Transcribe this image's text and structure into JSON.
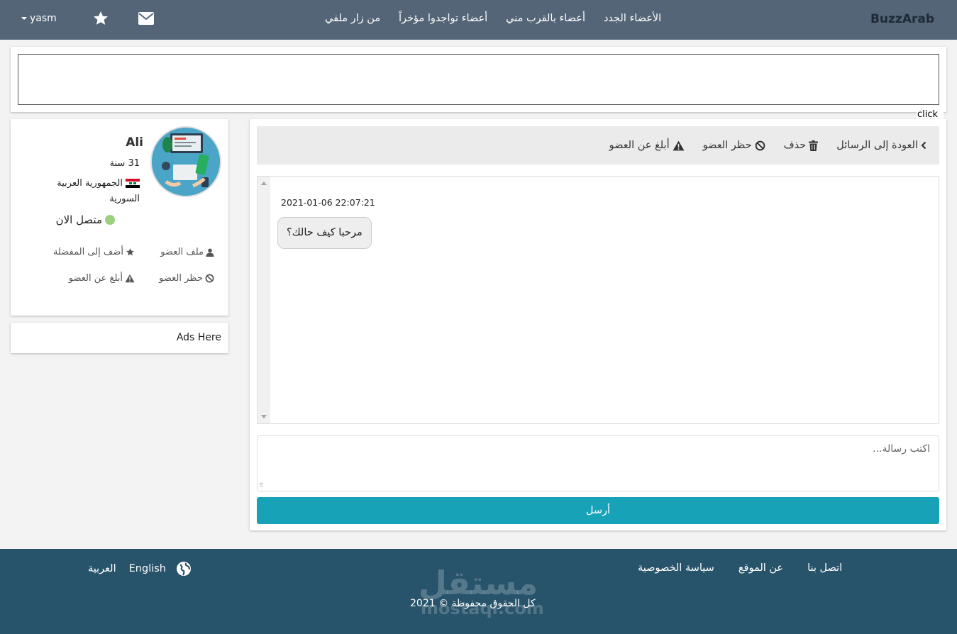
{
  "nav": {
    "brand": "BuzzArab",
    "links": [
      "الأعضاء الجدد",
      "أعضاء بالقرب مني",
      "أعضاء تواجدوا مؤخراً",
      "من زار ملفي"
    ],
    "username": "yasm",
    "icons": [
      "caret-down-icon",
      "star-icon",
      "envelope-icon"
    ]
  },
  "banner": {
    "click_label": "click"
  },
  "profile": {
    "name": "Ali",
    "age": "31 سنة",
    "country": "الجمهورية العربية السورية",
    "status": "متصل الان",
    "status_color": "#9cd07f",
    "actions": {
      "view_profile": "ملف العضو",
      "add_favorite": "أضف إلى المفضلة",
      "block": "حظر العضو",
      "report": "أبلغ عن العضو"
    }
  },
  "ads": {
    "label": "Ads Here"
  },
  "conversation": {
    "toolbar": {
      "back": "العودة إلى الرسائل",
      "delete": "حذف",
      "block": "حظر العضو",
      "report": "أبلغ عن العضو"
    },
    "messages": [
      {
        "time": "2021-01-06 22:07:21",
        "text": "مرحبا كيف حالك؟"
      }
    ],
    "compose_placeholder": "اكتب رسالة...",
    "send_label": "أرسل",
    "send_color": "#17a2b8"
  },
  "footer": {
    "links": [
      "اتصل بنا",
      "عن الموقع",
      "سياسة الخصوصية"
    ],
    "languages": [
      "English",
      "العربية"
    ],
    "copyright": "كل الحقوق محفوظة © 2021",
    "watermark": {
      "arabic": "مستقل",
      "latin": "mostaql.com"
    }
  },
  "colors": {
    "nav_bg": "#536577",
    "footer_bg": "#27536b",
    "page_bg": "#f3f3f3"
  }
}
